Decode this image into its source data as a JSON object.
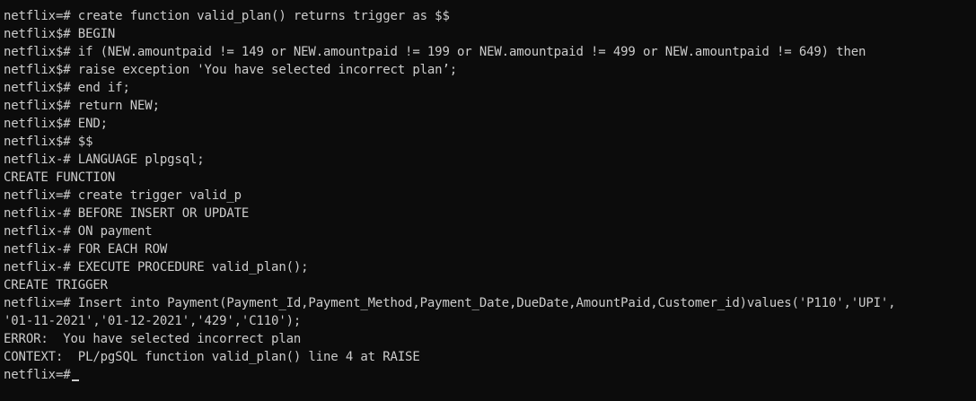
{
  "terminal": {
    "lines": [
      "netflix=# create function valid_plan() returns trigger as $$",
      "netflix$# BEGIN",
      "netflix$# if (NEW.amountpaid != 149 or NEW.amountpaid != 199 or NEW.amountpaid != 499 or NEW.amountpaid != 649) then",
      "netflix$# raise exception 'You have selected incorrect plan’;",
      "netflix$# end if;",
      "netflix$# return NEW;",
      "netflix$# END;",
      "netflix$# $$",
      "netflix-# LANGUAGE plpgsql;",
      "CREATE FUNCTION",
      "netflix=# create trigger valid_p",
      "netflix-# BEFORE INSERT OR UPDATE",
      "netflix-# ON payment",
      "netflix-# FOR EACH ROW",
      "netflix-# EXECUTE PROCEDURE valid_plan();",
      "CREATE TRIGGER",
      "netflix=# Insert into Payment(Payment_Id,Payment_Method,Payment_Date,DueDate,AmountPaid,Customer_id)values('P110','UPI',",
      "'01-11-2021','01-12-2021','429','C110');",
      "ERROR:  You have selected incorrect plan",
      "CONTEXT:  PL/pgSQL function valid_plan() line 4 at RAISE"
    ],
    "prompt": "netflix=#"
  },
  "colors": {
    "background": "#0c0c0c",
    "text": "#cccccc"
  }
}
